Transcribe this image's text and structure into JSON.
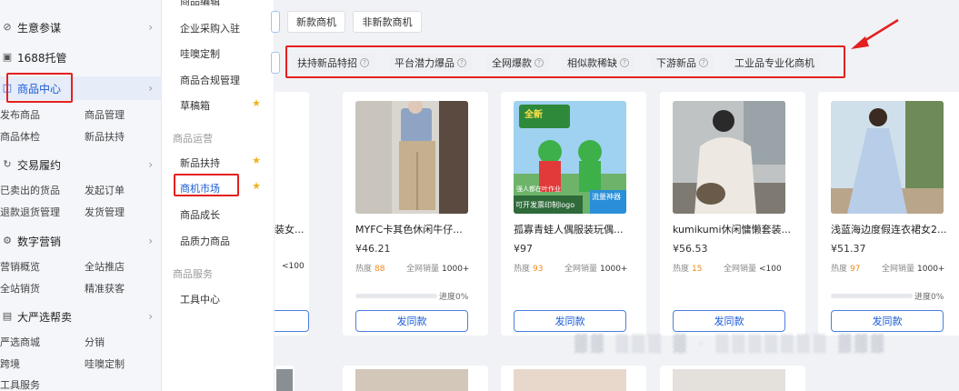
{
  "sidebar": {
    "sections": [
      {
        "name": "shengyi",
        "label": "生意参谋",
        "icon": "compass-icon"
      },
      {
        "name": "tuoguan",
        "label": "1688托管",
        "icon": "building-icon"
      },
      {
        "name": "shangpin",
        "label": "商品中心",
        "icon": "box-icon"
      },
      {
        "name": "jiaoyi",
        "label": "交易履约",
        "icon": "cycle-icon"
      },
      {
        "name": "shuzi",
        "label": "数字营销",
        "icon": "gear-icon"
      },
      {
        "name": "dayan",
        "label": "大严选帮卖",
        "icon": "doc-icon"
      }
    ],
    "subs": {
      "shangpin_1": "发布商品",
      "shangpin_2": "商品管理",
      "shangpin_3": "商品体检",
      "shangpin_4": "新品扶持",
      "jiaoyi_1": "已卖出的货品",
      "jiaoyi_2": "发起订单",
      "jiaoyi_3": "退款退货管理",
      "jiaoyi_4": "发货管理",
      "shuzi_1": "营销概览",
      "shuzi_2": "全站推店",
      "shuzi_3": "全站销货",
      "shuzi_4": "精准获客",
      "dayan_1": "严选商城",
      "dayan_2": "分销",
      "dayan_3": "跨境",
      "dayan_4": "哇噢定制",
      "tools": "工具服务"
    }
  },
  "menu2": {
    "top_partial": "商品编辑",
    "items_a": [
      "企业采购入驻",
      "哇噢定制",
      "商品合规管理",
      "草稿箱"
    ],
    "group_ops": "商品运营",
    "items_b": [
      "新品扶持",
      "商机市场",
      "商品成长",
      "品质力商品"
    ],
    "group_service": "商品服务",
    "items_c": [
      "工具中心"
    ]
  },
  "filters": {
    "type_tabs": [
      "新款商机",
      "非新款商机"
    ],
    "chips": [
      "扶持新品特招",
      "平台潜力爆品",
      "全网爆款",
      "相似款稀缺",
      "下游新品",
      "工业品专业化商机"
    ]
  },
  "cards": [
    {
      "title": "MYFC卡其色休闲牛仔...",
      "price": "¥46.21",
      "heat_label": "热度",
      "heat": "88",
      "sales_label": "全网销量",
      "sales": "1000+",
      "progress": "进度0%",
      "button": "发同款"
    },
    {
      "title": "孤寡青蛙人偶服装玩偶...",
      "price": "¥97",
      "heat_label": "热度",
      "heat": "93",
      "sales_label": "全网销量",
      "sales": "1000+",
      "progress": "",
      "button": "发同款"
    },
    {
      "title": "kumikumi休闲慵懒套装...",
      "price": "¥56.53",
      "heat_label": "热度",
      "heat": "15",
      "sales_label": "全网销量",
      "sales": "<100",
      "progress": "",
      "button": "发同款"
    },
    {
      "title": "浅蓝海边度假连衣裙女2...",
      "price": "¥51.37",
      "heat_label": "热度",
      "heat": "97",
      "sales_label": "全网销量",
      "sales": "1000+",
      "progress": "进度0%",
      "button": "发同款"
    }
  ],
  "partial_card": {
    "title": "装女...",
    "sales": "<100"
  },
  "frog_poster": {
    "line1": "全新",
    "line2": "可开发票印制logo",
    "line3": "流量神器",
    "line4": "强人都在叶作业"
  },
  "colors": {
    "accent": "#1a5bd6",
    "highlight_red": "#e42020",
    "heat_orange": "#f08a1c"
  }
}
